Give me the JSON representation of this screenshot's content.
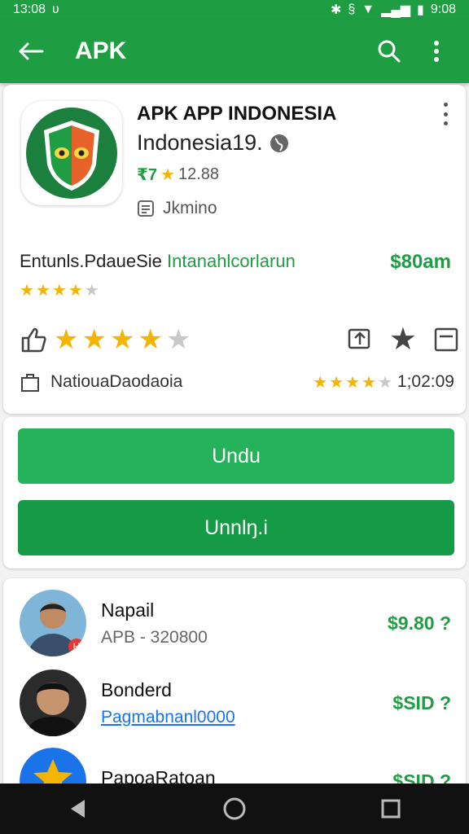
{
  "status_bar": {
    "time": "13:08",
    "mark": "ʋ",
    "battery_time": "9:08"
  },
  "app_bar": {
    "title": "APK"
  },
  "app": {
    "name": "APK APP INDONESIA",
    "developer": "Indonesia19.",
    "rating_prefix": "₹7",
    "rating_value": "12.88",
    "category": "Jkmino"
  },
  "details": {
    "left_text": "Entunls.Pdaue",
    "sie": "Sie",
    "accent_text": "Intanahlcorlarun",
    "price": "$80am",
    "small_stars": 3.5,
    "big_stars": 3.5,
    "meta_left": "NatiouaDaodaoia",
    "meta_right": "1;02:09",
    "meta_stars": 4
  },
  "buttons": {
    "primary": "Undu",
    "secondary": "Unnlŋ.i"
  },
  "list": [
    {
      "name": "Napail",
      "sub": "APB - 320800",
      "price": "$9.80 ?",
      "sub_link": false
    },
    {
      "name": "Bonderd",
      "sub": "Pagmabnanl0000",
      "price": "$SID ?",
      "sub_link": true
    },
    {
      "name": "PapoaRatoan",
      "sub": "",
      "price": "$SID ?",
      "sub_link": false
    }
  ],
  "colors": {
    "brand": "#1e9d43",
    "button_primary": "#25b25a",
    "button_secondary": "#159a45",
    "star": "#f4b400"
  }
}
